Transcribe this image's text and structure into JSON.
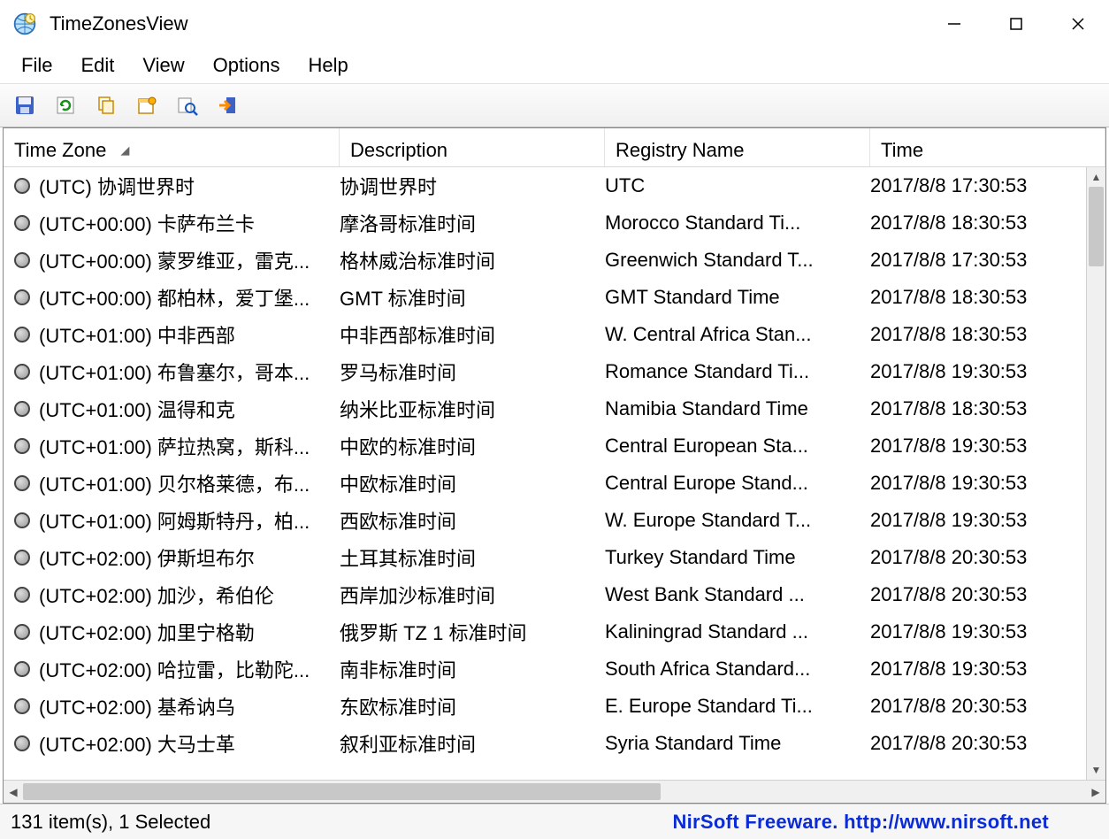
{
  "window": {
    "title": "TimeZonesView"
  },
  "menu": {
    "items": [
      "File",
      "Edit",
      "View",
      "Options",
      "Help"
    ]
  },
  "toolbar": {
    "icons": [
      "save-icon",
      "refresh-icon",
      "copy-icon",
      "properties-icon",
      "find-icon",
      "exit-icon"
    ]
  },
  "columns": {
    "time_zone": "Time Zone",
    "description": "Description",
    "registry_name": "Registry Name",
    "time": "Time",
    "sort_indicator": "◢"
  },
  "rows": [
    {
      "tz": "(UTC) 协调世界时",
      "desc": "协调世界时",
      "reg": "UTC",
      "time": "2017/8/8 17:30:53"
    },
    {
      "tz": "(UTC+00:00) 卡萨布兰卡",
      "desc": "摩洛哥标准时间",
      "reg": "Morocco Standard Ti...",
      "time": "2017/8/8 18:30:53"
    },
    {
      "tz": "(UTC+00:00) 蒙罗维亚，雷克...",
      "desc": "格林威治标准时间",
      "reg": "Greenwich Standard T...",
      "time": "2017/8/8 17:30:53"
    },
    {
      "tz": "(UTC+00:00) 都柏林，爱丁堡...",
      "desc": "GMT 标准时间",
      "reg": "GMT Standard Time",
      "time": "2017/8/8 18:30:53"
    },
    {
      "tz": "(UTC+01:00) 中非西部",
      "desc": "中非西部标准时间",
      "reg": "W. Central Africa Stan...",
      "time": "2017/8/8 18:30:53"
    },
    {
      "tz": "(UTC+01:00) 布鲁塞尔，哥本...",
      "desc": "罗马标准时间",
      "reg": "Romance Standard Ti...",
      "time": "2017/8/8 19:30:53"
    },
    {
      "tz": "(UTC+01:00) 温得和克",
      "desc": "纳米比亚标准时间",
      "reg": "Namibia Standard Time",
      "time": "2017/8/8 18:30:53"
    },
    {
      "tz": "(UTC+01:00) 萨拉热窝，斯科...",
      "desc": "中欧的标准时间",
      "reg": "Central European Sta...",
      "time": "2017/8/8 19:30:53"
    },
    {
      "tz": "(UTC+01:00) 贝尔格莱德，布...",
      "desc": "中欧标准时间",
      "reg": "Central Europe Stand...",
      "time": "2017/8/8 19:30:53"
    },
    {
      "tz": "(UTC+01:00) 阿姆斯特丹，柏...",
      "desc": "西欧标准时间",
      "reg": "W. Europe Standard T...",
      "time": "2017/8/8 19:30:53"
    },
    {
      "tz": "(UTC+02:00) 伊斯坦布尔",
      "desc": "土耳其标准时间",
      "reg": "Turkey Standard Time",
      "time": "2017/8/8 20:30:53"
    },
    {
      "tz": "(UTC+02:00) 加沙，希伯伦",
      "desc": "西岸加沙标准时间",
      "reg": "West Bank Standard ...",
      "time": "2017/8/8 20:30:53"
    },
    {
      "tz": "(UTC+02:00) 加里宁格勒",
      "desc": "俄罗斯 TZ 1 标准时间",
      "reg": "Kaliningrad Standard ...",
      "time": "2017/8/8 19:30:53"
    },
    {
      "tz": "(UTC+02:00) 哈拉雷，比勒陀...",
      "desc": "南非标准时间",
      "reg": "South Africa Standard...",
      "time": "2017/8/8 19:30:53"
    },
    {
      "tz": "(UTC+02:00) 基希讷乌",
      "desc": "东欧标准时间",
      "reg": "E. Europe Standard Ti...",
      "time": "2017/8/8 20:30:53"
    },
    {
      "tz": "(UTC+02:00) 大马士革",
      "desc": "叙利亚标准时间",
      "reg": "Syria Standard Time",
      "time": "2017/8/8 20:30:53"
    }
  ],
  "status": {
    "left": "131 item(s), 1 Selected",
    "right": "NirSoft Freeware.  http://www.nirsoft.net"
  }
}
